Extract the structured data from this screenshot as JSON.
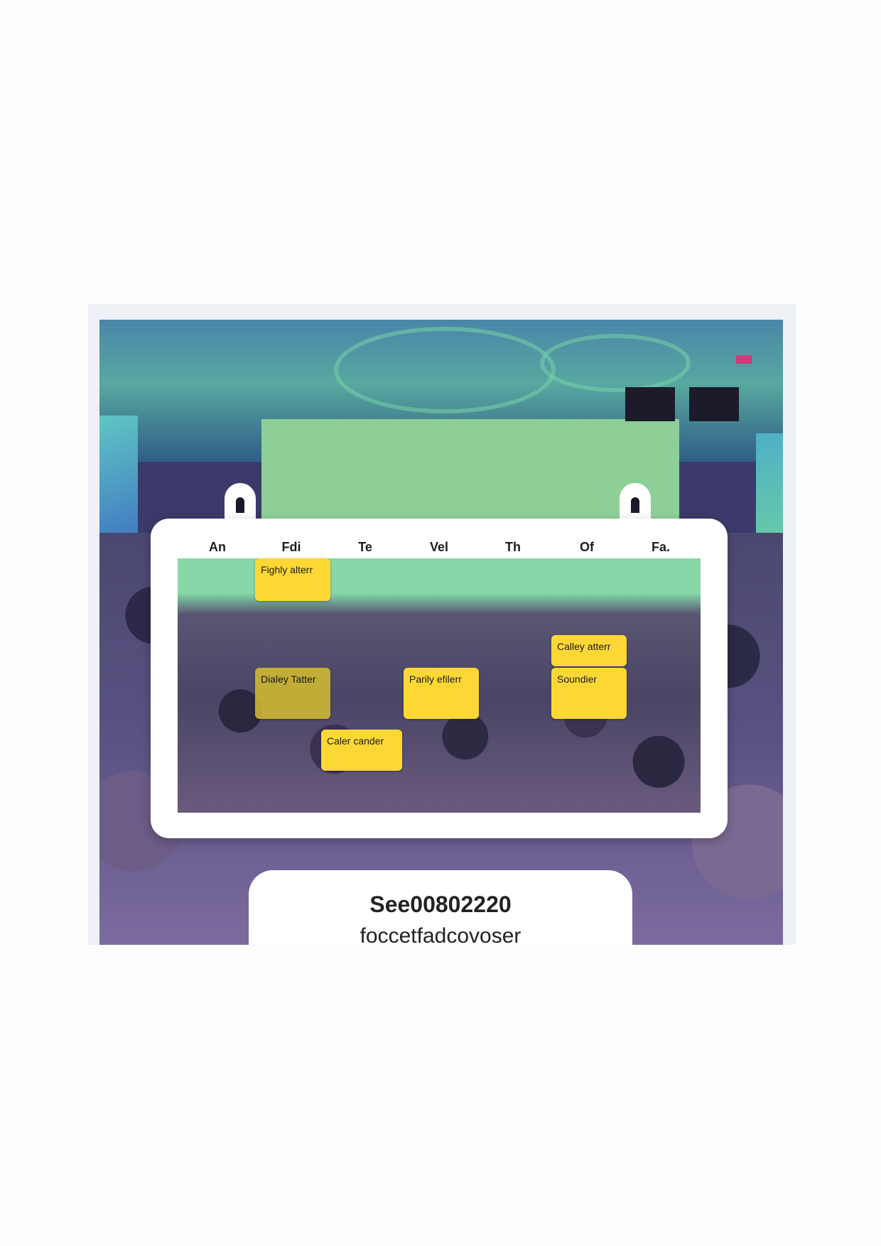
{
  "calendar": {
    "days": [
      "An",
      "Fdi",
      "Te",
      "Vel",
      "Th",
      "Of",
      "Fa."
    ],
    "events": [
      {
        "label": "Fighly alterr"
      },
      {
        "label": "Calley atterr"
      },
      {
        "label": "Dialey Tatter"
      },
      {
        "label": "Parily efilerr"
      },
      {
        "label": "Soundier"
      },
      {
        "label": "Caler cander"
      }
    ]
  },
  "info": {
    "title": "See00802220",
    "subtitle": "foccetfadcovoser"
  },
  "colors": {
    "event": "#fdd835",
    "stage_screen": "#8ecf98",
    "card": "#ffffff"
  }
}
